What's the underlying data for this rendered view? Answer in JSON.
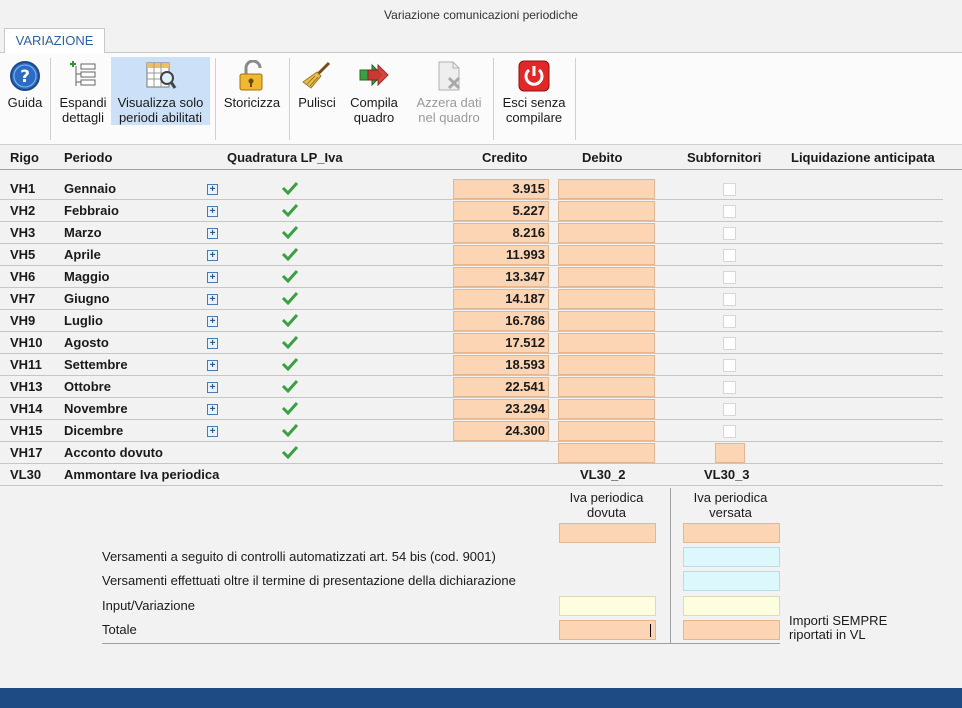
{
  "window": {
    "title": "Variazione comunicazioni periodiche"
  },
  "tabs": [
    {
      "label": "VARIAZIONE"
    }
  ],
  "toolbar": {
    "guida": "Guida",
    "espandi": [
      "Espandi",
      "dettagli"
    ],
    "visualizza": [
      "Visualizza solo",
      "periodi abilitati"
    ],
    "storicizza": "Storicizza",
    "pulisci": "Pulisci",
    "compila": [
      "Compila",
      "quadro"
    ],
    "azzera": [
      "Azzera dati",
      "nel quadro"
    ],
    "esci": [
      "Esci senza",
      "compilare"
    ]
  },
  "columns": {
    "rigo": "Rigo",
    "periodo": "Periodo",
    "quadratura": "Quadratura LP_Iva",
    "credito": "Credito",
    "debito": "Debito",
    "subfornitori": "Subfornitori",
    "liquidazione": "Liquidazione anticipata"
  },
  "rows": [
    {
      "rigo": "VH1",
      "periodo": "Gennaio",
      "credito": "3.915"
    },
    {
      "rigo": "VH2",
      "periodo": "Febbraio",
      "credito": "5.227"
    },
    {
      "rigo": "VH3",
      "periodo": "Marzo",
      "credito": "8.216"
    },
    {
      "rigo": "VH5",
      "periodo": "Aprile",
      "credito": "11.993"
    },
    {
      "rigo": "VH6",
      "periodo": "Maggio",
      "credito": "13.347"
    },
    {
      "rigo": "VH7",
      "periodo": "Giugno",
      "credito": "14.187"
    },
    {
      "rigo": "VH9",
      "periodo": "Luglio",
      "credito": "16.786"
    },
    {
      "rigo": "VH10",
      "periodo": "Agosto",
      "credito": "17.512"
    },
    {
      "rigo": "VH11",
      "periodo": "Settembre",
      "credito": "18.593"
    },
    {
      "rigo": "VH13",
      "periodo": "Ottobre",
      "credito": "22.541"
    },
    {
      "rigo": "VH14",
      "periodo": "Novembre",
      "credito": "23.294"
    },
    {
      "rigo": "VH15",
      "periodo": "Dicembre",
      "credito": "24.300"
    }
  ],
  "acconto": {
    "rigo": "VH17",
    "periodo": "Acconto dovuto"
  },
  "vl30": {
    "rigo": "VL30",
    "label": "Ammontare Iva periodica",
    "col2": "VL30_2",
    "col3": "VL30_3",
    "col2_desc": [
      "Iva periodica",
      "dovuta"
    ],
    "col3_desc": [
      "Iva periodica",
      "versata"
    ],
    "lines": {
      "versamenti_controlli": "Versamenti a seguito di controlli automatizzati art. 54 bis (cod. 9001)",
      "versamenti_oltre": "Versamenti effettuati oltre il termine di presentazione della dichiarazione",
      "input": "Input/Variazione",
      "totale": "Totale"
    },
    "note": [
      "Importi SEMPRE",
      "riportati in VL"
    ]
  },
  "colors": {
    "peach": "#fcd5b4",
    "cyan": "#dcf8fc",
    "yellow": "#fdfde0",
    "footer": "#1f4b84",
    "accent": "#2a62a8"
  }
}
